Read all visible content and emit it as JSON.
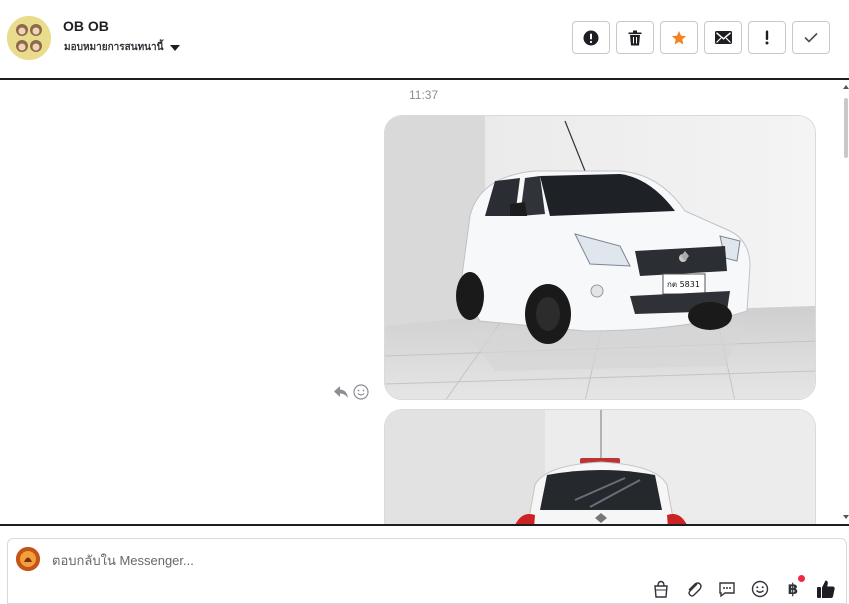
{
  "header": {
    "contact_name": "OB OB",
    "assign_label": "มอบหมายการสนทนานี้",
    "actions": [
      {
        "name": "alert-icon"
      },
      {
        "name": "trash-icon"
      },
      {
        "name": "star-icon",
        "color": "#f5821f"
      },
      {
        "name": "envelope-icon"
      },
      {
        "name": "exclamation-icon",
        "label": "!"
      },
      {
        "name": "check-icon"
      }
    ]
  },
  "conversation": {
    "timestamp": "11:37",
    "messages": [
      {
        "type": "photo",
        "subject": "white Suzuki Celerio hatchback, front view",
        "plate": "กต 5831"
      },
      {
        "type": "photo",
        "subject": "white Suzuki Celerio hatchback, rear view"
      }
    ]
  },
  "composer": {
    "placeholder": "ตอบกลับใน Messenger...",
    "tools": [
      "bag-icon",
      "paperclip-icon",
      "saved-reply-icon",
      "emoji-icon",
      "baht-icon",
      "like-icon"
    ],
    "baht_symbol": "฿"
  }
}
